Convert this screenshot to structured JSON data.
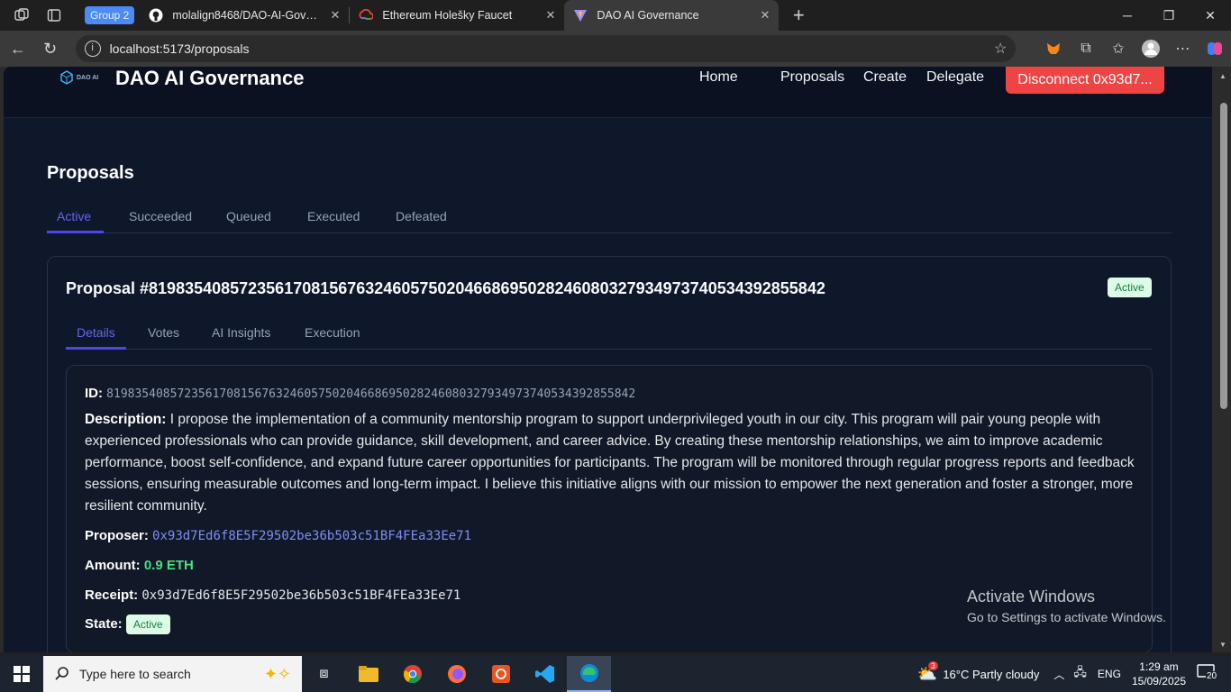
{
  "browser": {
    "group_label": "Group 2",
    "tabs": [
      {
        "title": "molalign8468/DAO-AI-Governance",
        "close": "✕"
      },
      {
        "title": "Ethereum Holešky Faucet",
        "close": "✕"
      },
      {
        "title": "DAO AI Governance",
        "close": "✕"
      }
    ],
    "new_tab": "+",
    "url": "localhost:5173/proposals"
  },
  "site": {
    "logo_text": "DAO AI",
    "brand": "DAO AI Governance",
    "nav": {
      "home": "Home",
      "proposals": "Proposals",
      "create": "Create",
      "delegate": "Delegate"
    },
    "disconnect": "Disconnect 0x93d7...",
    "page_title": "Proposals",
    "status_tabs": [
      "Active",
      "Succeeded",
      "Queued",
      "Executed",
      "Defeated"
    ]
  },
  "proposal": {
    "title": "Proposal #81983540857235617081567632460575020466869502824608032793497374053439285584‍2",
    "status_badge": "Active",
    "tabs": [
      "Details",
      "Votes",
      "AI Insights",
      "Execution"
    ],
    "id_label": "ID:",
    "id_value": "81983540857235617081567632460575020466869502824608032793497374053439285584‍2",
    "description_label": "Description:",
    "description": "I propose the implementation of a community mentorship program to support underprivileged youth in our city. This program will pair young people with experienced professionals who can provide guidance, skill development, and career advice. By creating these mentorship relationships, we aim to improve academic performance, boost self-confidence, and expand future career opportunities for participants. The program will be monitored through regular progress reports and feedback sessions, ensuring measurable outcomes and long-term impact. I believe this initiative aligns with our mission to empower the next generation and foster a stronger, more resilient community.",
    "proposer_label": "Proposer:",
    "proposer": "0x93d7Ed6f8E5F29502be36b503c51BF4FEa33Ee71",
    "amount_label": "Amount:",
    "amount": "0.9 ETH",
    "receipt_label": "Receipt:",
    "receipt": "0x93d7Ed6f8E5F29502be36b503c51BF4FEa33Ee71",
    "state_label": "State:",
    "state": "Active"
  },
  "watermark": {
    "line1": "Activate Windows",
    "line2": "Go to Settings to activate Windows."
  },
  "taskbar": {
    "search_placeholder": "Type here to search",
    "weather": "16°C  Partly cloudy",
    "weather_badge": "3",
    "lang": "ENG",
    "time": "1:29 am",
    "date": "15/09/2025",
    "notif_count": "20"
  },
  "colors": {
    "accent": "#6366f1",
    "danger": "#ef4444",
    "success": "#4ade80",
    "page_bg": "#0f172a"
  }
}
